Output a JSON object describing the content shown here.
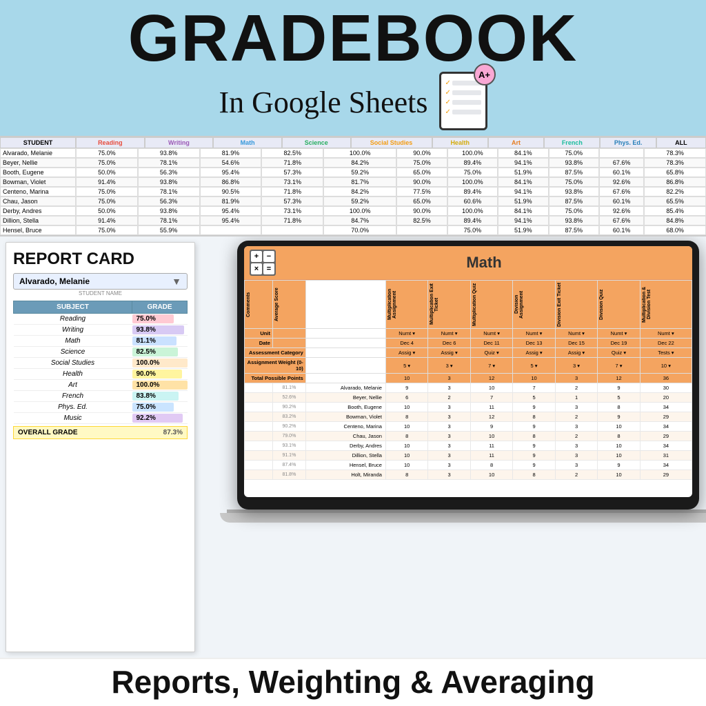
{
  "header": {
    "title": "GRADEBOOK",
    "subtitle": "In Google Sheets",
    "grade_badge": "A+"
  },
  "spreadsheet": {
    "columns": [
      "STUDENT",
      "Reading",
      "Writing",
      "Math",
      "Science",
      "Social Studies",
      "Health",
      "Art",
      "French",
      "Phys. Ed.",
      "ALL"
    ],
    "rows": [
      [
        "Alvarado, Melanie",
        "75.0%",
        "93.8%",
        "81.9%",
        "82.5%",
        "100.0%",
        "90.0%",
        "100.0%",
        "84.1%",
        "75.0%",
        "",
        "78.3%"
      ],
      [
        "Beyer, Nellie",
        "75.0%",
        "78.1%",
        "54.6%",
        "71.8%",
        "84.2%",
        "75.0%",
        "89.4%",
        "94.1%",
        "93.8%",
        "67.6%",
        "78.3%"
      ],
      [
        "Booth, Eugene",
        "50.0%",
        "56.3%",
        "95.4%",
        "57.3%",
        "59.2%",
        "65.0%",
        "75.0%",
        "51.9%",
        "87.5%",
        "60.1%",
        "65.8%"
      ],
      [
        "Bowman, Violet",
        "91.4%",
        "93.8%",
        "86.8%",
        "73.1%",
        "81.7%",
        "90.0%",
        "100.0%",
        "84.1%",
        "75.0%",
        "92.6%",
        "86.8%"
      ],
      [
        "Centeno, Marina",
        "75.0%",
        "78.1%",
        "90.5%",
        "71.8%",
        "84.2%",
        "77.5%",
        "89.4%",
        "94.1%",
        "93.8%",
        "67.6%",
        "82.2%"
      ],
      [
        "Chau, Jason",
        "75.0%",
        "56.3%",
        "81.9%",
        "57.3%",
        "59.2%",
        "65.0%",
        "60.6%",
        "51.9%",
        "87.5%",
        "60.1%",
        "65.5%"
      ],
      [
        "Derby, Andres",
        "50.0%",
        "93.8%",
        "95.4%",
        "73.1%",
        "100.0%",
        "90.0%",
        "100.0%",
        "84.1%",
        "75.0%",
        "92.6%",
        "85.4%"
      ],
      [
        "Dillion, Stella",
        "91.4%",
        "78.1%",
        "95.4%",
        "71.8%",
        "84.7%",
        "82.5%",
        "89.4%",
        "94.1%",
        "93.8%",
        "67.6%",
        "84.8%"
      ],
      [
        "Hensel, Bruce",
        "75.0%",
        "55.9%",
        "",
        "",
        "70.0%",
        "",
        "75.0%",
        "51.9%",
        "87.5%",
        "60.1%",
        "68.0%"
      ]
    ]
  },
  "report_card": {
    "title": "REPORT CARD",
    "student_name": "Alvarado, Melanie",
    "student_label": "STUDENT NAME",
    "overall_label": "OVERALL GRADE",
    "overall_grade": "87.3%",
    "col_subject": "SUBJECT",
    "col_grade": "GRADE",
    "subjects": [
      {
        "name": "Reading",
        "grade": "75.0%",
        "color": "#ffb3c1",
        "pct": 75
      },
      {
        "name": "Writing",
        "grade": "93.8%",
        "color": "#c8b4f0",
        "pct": 94
      },
      {
        "name": "Math",
        "grade": "81.1%",
        "color": "#b3d4ff",
        "pct": 81
      },
      {
        "name": "Science",
        "grade": "82.5%",
        "color": "#b3f0c8",
        "pct": 83
      },
      {
        "name": "Social Studies",
        "grade": "100.0%",
        "color": "#ffe0b3",
        "pct": 100
      },
      {
        "name": "Health",
        "grade": "90.0%",
        "color": "#fff176",
        "pct": 90
      },
      {
        "name": "Art",
        "grade": "100.0%",
        "color": "#ffd580",
        "pct": 100
      },
      {
        "name": "French",
        "grade": "83.8%",
        "color": "#b3f0ee",
        "pct": 84
      },
      {
        "name": "Phys. Ed.",
        "grade": "75.0%",
        "color": "#b3d9ff",
        "pct": 75
      },
      {
        "name": "Music",
        "grade": "92.2%",
        "color": "#d4b3f0",
        "pct": 92
      }
    ]
  },
  "math_gradebook": {
    "title": "Math",
    "ops": [
      "+",
      "-",
      "×",
      "="
    ],
    "col_headers": [
      "Multiplication Assignment",
      "Multiplication Exit Ticket",
      "Multiplication Quiz",
      "Division Assignment",
      "Division Exit Ticket",
      "Division Quiz",
      "Multiplication & Division Test"
    ],
    "dates": [
      "Dec 4",
      "Dec 6",
      "Dec 11",
      "Dec 13",
      "Dec 15",
      "Dec 19",
      "Dec 22"
    ],
    "categories": [
      "Assig.",
      "Assig.",
      "Quiz",
      "Assig.",
      "Assig.",
      "Quiz",
      "Tests"
    ],
    "weights": [
      "5",
      "3",
      "7",
      "5",
      "3",
      "7",
      "10"
    ],
    "total_points": [
      "10",
      "3",
      "12",
      "10",
      "3",
      "12",
      "36"
    ],
    "rows": [
      {
        "pct": "81.1%",
        "name": "Alvarado, Melanie",
        "scores": [
          "9",
          "3",
          "10",
          "7",
          "2",
          "9",
          "30"
        ]
      },
      {
        "pct": "52.6%",
        "name": "Beyer, Nellie",
        "scores": [
          "6",
          "2",
          "7",
          "5",
          "1",
          "5",
          "20"
        ]
      },
      {
        "pct": "90.2%",
        "name": "Booth, Eugene",
        "scores": [
          "10",
          "3",
          "11",
          "9",
          "3",
          "8",
          "34"
        ]
      },
      {
        "pct": "83.2%",
        "name": "Bowman, Violet",
        "scores": [
          "8",
          "3",
          "12",
          "8",
          "2",
          "9",
          "29"
        ]
      },
      {
        "pct": "90.2%",
        "name": "Centeno, Marina",
        "scores": [
          "10",
          "3",
          "9",
          "9",
          "3",
          "10",
          "34"
        ]
      },
      {
        "pct": "79.0%",
        "name": "Chau, Jason",
        "scores": [
          "8",
          "3",
          "10",
          "8",
          "2",
          "8",
          "29"
        ]
      },
      {
        "pct": "93.1%",
        "name": "Derby, Andres",
        "scores": [
          "10",
          "3",
          "11",
          "9",
          "3",
          "10",
          "34"
        ]
      },
      {
        "pct": "91.1%",
        "name": "Dillion, Stella",
        "scores": [
          "10",
          "3",
          "11",
          "9",
          "3",
          "10",
          "31"
        ]
      },
      {
        "pct": "87.4%",
        "name": "Hensel, Bruce",
        "scores": [
          "10",
          "3",
          "8",
          "9",
          "3",
          "9",
          "34"
        ]
      },
      {
        "pct": "81.8%",
        "name": "Holt, Miranda",
        "scores": [
          "8",
          "3",
          "10",
          "8",
          "2",
          "10",
          "29"
        ]
      }
    ]
  },
  "bottom": {
    "text": "Reports, Weighting & Averaging"
  }
}
